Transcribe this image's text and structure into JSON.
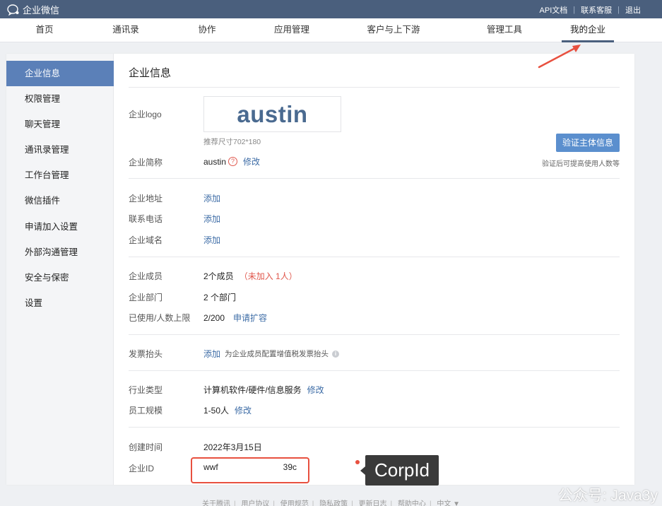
{
  "topbar": {
    "brand": "企业微信",
    "links": [
      "API文档",
      "联系客服",
      "退出"
    ]
  },
  "nav": {
    "items": [
      "首页",
      "通讯录",
      "协作",
      "应用管理",
      "客户与上下游",
      "管理工具",
      "我的企业"
    ],
    "active": "我的企业"
  },
  "sidebar": {
    "items": [
      "企业信息",
      "权限管理",
      "聊天管理",
      "通讯录管理",
      "工作台管理",
      "微信插件",
      "申请加入设置",
      "外部沟通管理",
      "安全与保密",
      "设置"
    ],
    "active": "企业信息"
  },
  "content": {
    "title": "企业信息",
    "logo": {
      "label": "企业logo",
      "text": "austin",
      "hint": "推荐尺寸702*180"
    },
    "verify": {
      "button": "验证主体信息",
      "hint": "验证后可提高使用人数等"
    },
    "short_name": {
      "label": "企业简称",
      "value": "austin",
      "icon": "?",
      "action": "修改"
    },
    "address": {
      "label": "企业地址",
      "action": "添加"
    },
    "phone": {
      "label": "联系电话",
      "action": "添加"
    },
    "domain": {
      "label": "企业域名",
      "action": "添加"
    },
    "members": {
      "label": "企业成员",
      "value": "2个成员",
      "note": "（未加入 1人）"
    },
    "departments": {
      "label": "企业部门",
      "value": "2 个部门"
    },
    "usage": {
      "label": "已使用/人数上限",
      "value": "2/200",
      "action": "申请扩容"
    },
    "invoice": {
      "label": "发票抬头",
      "action": "添加",
      "hint": "为企业成员配置增值税发票抬头",
      "icon": "i"
    },
    "industry": {
      "label": "行业类型",
      "value": "计算机软件/硬件/信息服务",
      "action": "修改"
    },
    "size": {
      "label": "员工规模",
      "value": "1-50人",
      "action": "修改"
    },
    "created": {
      "label": "创建时间",
      "value": "2022年3月15日"
    },
    "corp_id": {
      "label": "企业ID",
      "value_start": "wwf",
      "value_end": "39c"
    }
  },
  "annotation": {
    "callout": "CorpId"
  },
  "footer": {
    "links": [
      "关于腾讯",
      "用户协议",
      "使用规范",
      "隐私政策",
      "更新日志",
      "帮助中心",
      "中文 ▼"
    ]
  },
  "watermark": "公众号: Java3y",
  "colors": {
    "topbar": "#4a5f7d",
    "accent": "#5b80b8",
    "link": "#3d6ca6",
    "warn": "#e0584d",
    "highlight": "#e8503f"
  }
}
